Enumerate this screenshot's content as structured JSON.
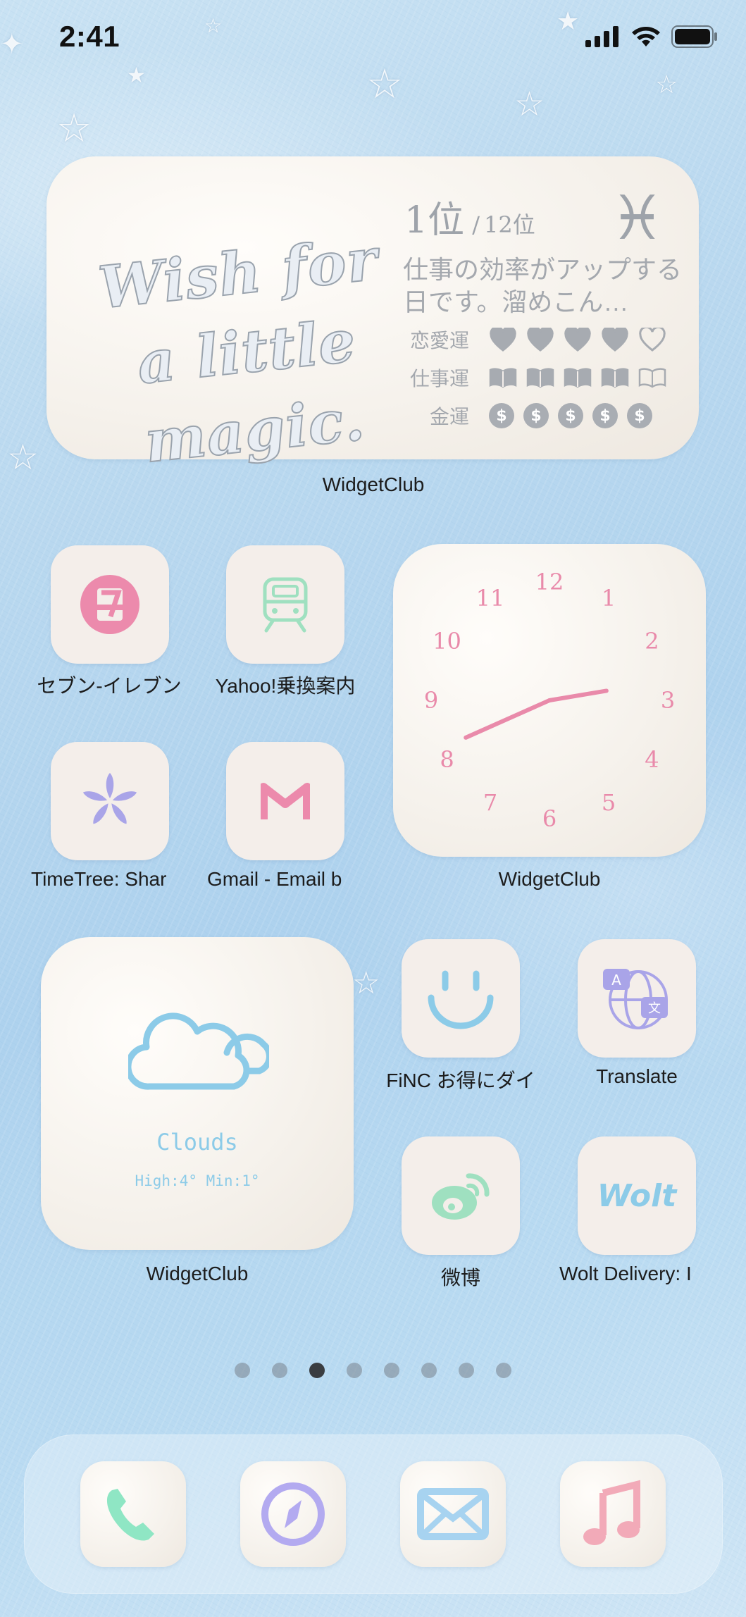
{
  "status_bar": {
    "time": "2:41"
  },
  "horoscope_widget": {
    "slogan": "Wish for a little magic.",
    "rank": "1",
    "rank_suffix": "位",
    "rank_total": "12位",
    "rank_separator": "/",
    "sign_symbol": "♓",
    "message": "仕事の効率がアップする日です。溜めこん…",
    "love_label": "恋愛運",
    "love_level": 4,
    "work_label": "仕事運",
    "work_level": 4,
    "money_label": "金運",
    "money_level": 5,
    "app_label": "WidgetClub"
  },
  "apps": {
    "seven_eleven": "セブン-イレブン",
    "yahoo_transit": "Yahoo!乗換案内",
    "timetree": "TimeTree: Shar",
    "gmail": "Gmail - Email b",
    "finc": "FiNC お得にダイ",
    "translate": "Translate",
    "weibo": "微博",
    "wolt": "Wolt Delivery: I",
    "wolt_icon_text": "Wolt"
  },
  "clock_widget": {
    "numbers": [
      "12",
      "1",
      "2",
      "3",
      "4",
      "5",
      "6",
      "7",
      "8",
      "9",
      "10",
      "11"
    ],
    "hour": 2,
    "minute": 41,
    "label": "WidgetClub"
  },
  "weather_widget": {
    "condition": "Clouds",
    "high_low": "High:4° Min:1°",
    "label": "WidgetClub"
  },
  "page_dots": {
    "count": 8,
    "active_index": 2
  },
  "dock": [
    "phone-icon",
    "safari-icon",
    "mail-icon",
    "music-icon"
  ],
  "colors": {
    "accent_pink": "#e98aaa",
    "accent_blue": "#8ccbe8",
    "accent_purple": "#a9a4e8",
    "accent_green": "#9fe0c0"
  }
}
